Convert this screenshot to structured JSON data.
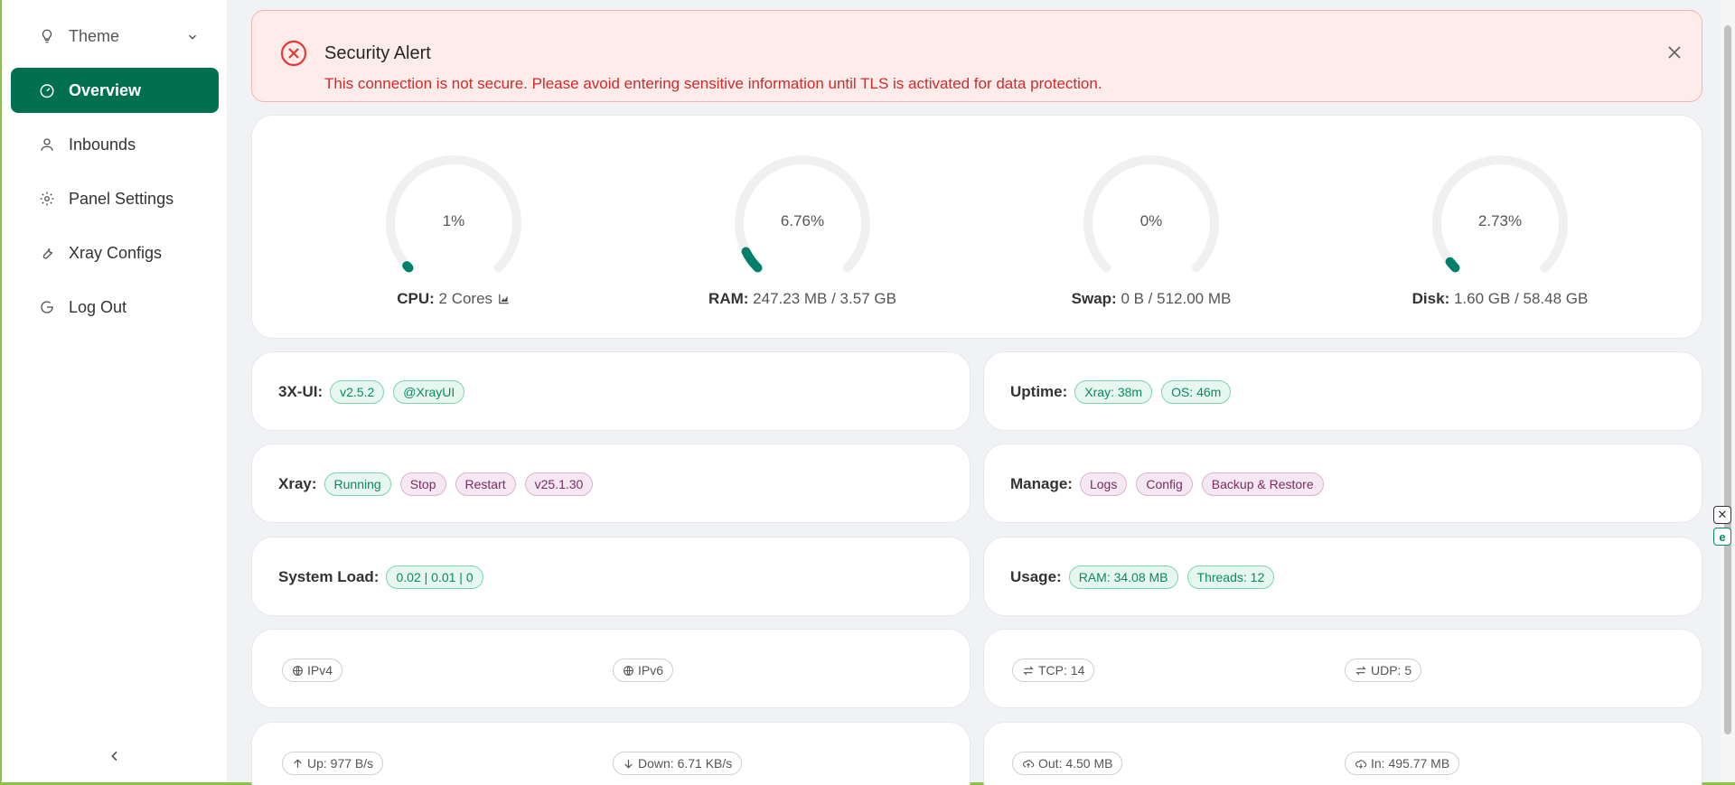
{
  "sidebar": {
    "theme_label": "Theme",
    "items": [
      {
        "label": "Overview"
      },
      {
        "label": "Inbounds"
      },
      {
        "label": "Panel Settings"
      },
      {
        "label": "Xray Configs"
      },
      {
        "label": "Log Out"
      }
    ],
    "collapse_glyph": "<"
  },
  "alert": {
    "title": "Security Alert",
    "message": "This connection is not secure. Please avoid entering sensitive information until TLS is activated for data protection."
  },
  "gauges": [
    {
      "name": "CPU",
      "percent_text": "1%",
      "percent": 1,
      "label": "CPU:",
      "detail": "2 Cores"
    },
    {
      "name": "RAM",
      "percent_text": "6.76%",
      "percent": 6.76,
      "label": "RAM:",
      "detail": "247.23 MB / 3.57 GB"
    },
    {
      "name": "Swap",
      "percent_text": "0%",
      "percent": 0,
      "label": "Swap:",
      "detail": "0 B / 512.00 MB"
    },
    {
      "name": "Disk",
      "percent_text": "2.73%",
      "percent": 2.73,
      "label": "Disk:",
      "detail": "1.60 GB / 58.48 GB"
    }
  ],
  "info": {
    "ui_label": "3X-UI:",
    "ui_version": "v2.5.2",
    "ui_channel": "@XrayUI",
    "uptime_label": "Uptime:",
    "uptime_xray": "Xray: 38m",
    "uptime_os": "OS: 46m",
    "xray_label": "Xray:",
    "xray_status": "Running",
    "xray_stop": "Stop",
    "xray_restart": "Restart",
    "xray_version": "v25.1.30",
    "manage_label": "Manage:",
    "manage_logs": "Logs",
    "manage_config": "Config",
    "manage_backup": "Backup & Restore",
    "load_label": "System Load:",
    "load_value": "0.02 | 0.01 | 0",
    "usage_label": "Usage:",
    "usage_ram": "RAM: 34.08 MB",
    "usage_threads": "Threads: 12",
    "ipv4": "IPv4",
    "ipv6": "IPv6",
    "tcp": "TCP: 14",
    "udp": "UDP: 5",
    "up": "Up: 977 B/s",
    "down": "Down: 6.71 KB/s",
    "out": "Out: 4.50 MB",
    "in": "In: 495.77 MB"
  },
  "colors": {
    "accent": "#00704f",
    "gauge_track": "#f0f0f0",
    "gauge_fill": "#00806b",
    "alert_red": "#cf2b2b"
  }
}
